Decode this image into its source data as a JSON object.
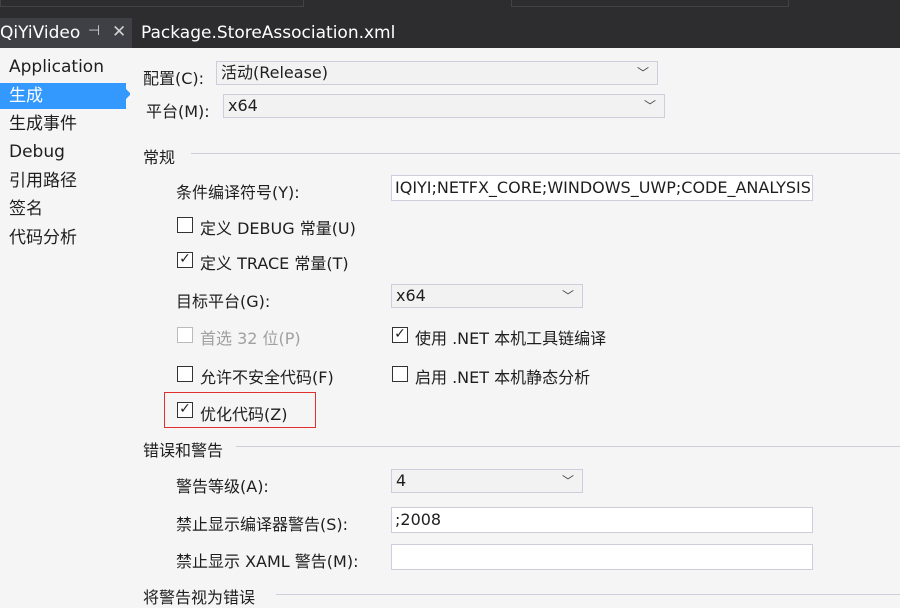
{
  "tabs": {
    "active_label": "QiYiVideo",
    "second_label": "Package.StoreAssociation.xml"
  },
  "sidebar": {
    "items": [
      {
        "label": "Application"
      },
      {
        "label": "生成"
      },
      {
        "label": "生成事件"
      },
      {
        "label": "Debug"
      },
      {
        "label": "引用路径"
      },
      {
        "label": "签名"
      },
      {
        "label": "代码分析"
      }
    ],
    "selected_index": 1
  },
  "config": {
    "label": "配置(C):",
    "value": "活动(Release)"
  },
  "platform": {
    "label": "平台(M):",
    "value": "x64"
  },
  "general": {
    "section_title": "常规",
    "conditional_symbols": {
      "label": "条件编译符号(Y):",
      "value": "IQIYI;NETFX_CORE;WINDOWS_UWP;CODE_ANALYSIS"
    },
    "define_debug": {
      "label": "定义 DEBUG 常量(U)",
      "checked": false
    },
    "define_trace": {
      "label": "定义 TRACE 常量(T)",
      "checked": true
    },
    "target_platform": {
      "label": "目标平台(G):",
      "value": "x64"
    },
    "prefer32": {
      "label": "首选 32 位(P)",
      "checked": false,
      "enabled": false
    },
    "native_toolchain": {
      "label": "使用 .NET 本机工具链编译",
      "checked": true
    },
    "allow_unsafe": {
      "label": "允许不安全代码(F)",
      "checked": false
    },
    "native_static": {
      "label": "启用 .NET 本机静态分析",
      "checked": false
    },
    "optimize": {
      "label": "优化代码(Z)",
      "checked": true
    }
  },
  "errors": {
    "section_title": "错误和警告",
    "warning_level": {
      "label": "警告等级(A):",
      "value": "4"
    },
    "suppress_compiler": {
      "label": "禁止显示编译器警告(S):",
      "value": ";2008"
    },
    "suppress_xaml": {
      "label": "禁止显示 XAML 警告(M):",
      "value": ""
    }
  },
  "treat_warnings": {
    "section_title": "将警告视为错误"
  },
  "colors": {
    "accent": "#3399ff",
    "highlight": "#e03030",
    "tab_bg": "#2d2d30"
  }
}
